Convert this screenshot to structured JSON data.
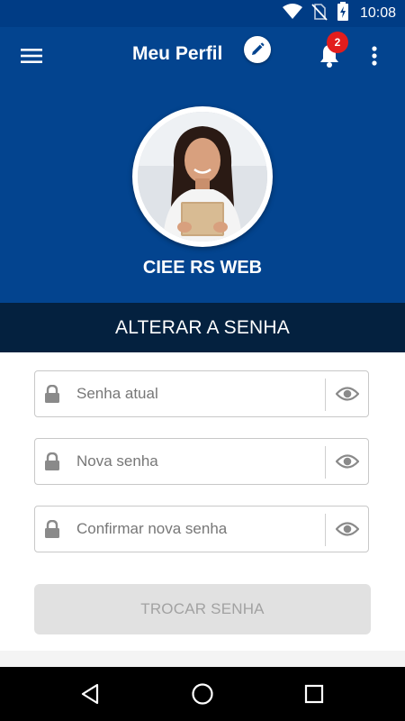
{
  "status_bar": {
    "time": "10:08",
    "icons": [
      "wifi-icon",
      "no-sim-icon",
      "battery-charging-icon"
    ]
  },
  "app_bar": {
    "title": "Meu Perfil",
    "menu_icon": "hamburger-menu-icon",
    "notification_icon": "bell-icon",
    "notification_count": "2",
    "more_icon": "more-vertical-icon"
  },
  "profile": {
    "name": "CIEE RS WEB",
    "edit_icon": "pencil-icon"
  },
  "section": {
    "title": "ALTERAR A SENHA"
  },
  "fields": {
    "current_password": {
      "placeholder": "Senha atual",
      "value": ""
    },
    "new_password": {
      "placeholder": "Nova senha",
      "value": ""
    },
    "confirm_password": {
      "placeholder": "Confirmar nova senha",
      "value": ""
    }
  },
  "submit": {
    "label": "TROCAR SENHA"
  },
  "nav_bar": {
    "icons": [
      "back-icon",
      "home-icon",
      "recents-icon"
    ]
  },
  "colors": {
    "primary": "#03448f",
    "section_bar": "#04213f",
    "badge": "#e21d1d",
    "button_disabled": "#e1e1e1"
  }
}
